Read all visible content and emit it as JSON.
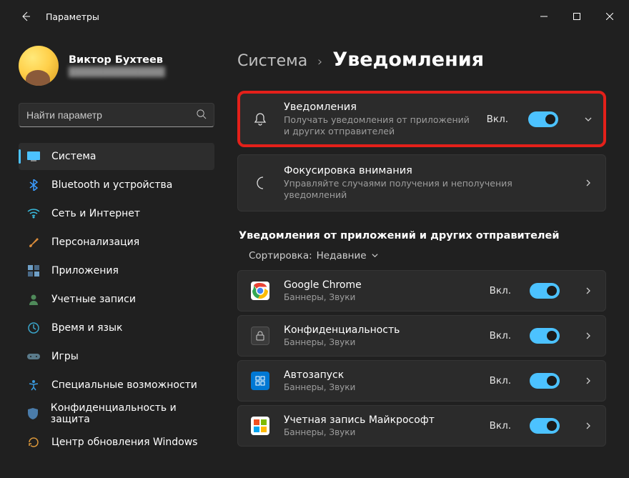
{
  "titlebar": {
    "title": "Параметры"
  },
  "profile": {
    "name": "Виктор Бухтеев",
    "email": "██████████████"
  },
  "search": {
    "placeholder": "Найти параметр"
  },
  "sidebar": {
    "items": [
      {
        "label": "Система",
        "active": true
      },
      {
        "label": "Bluetooth и устройства",
        "active": false
      },
      {
        "label": "Сеть и Интернет",
        "active": false
      },
      {
        "label": "Персонализация",
        "active": false
      },
      {
        "label": "Приложения",
        "active": false
      },
      {
        "label": "Учетные записи",
        "active": false
      },
      {
        "label": "Время и язык",
        "active": false
      },
      {
        "label": "Игры",
        "active": false
      },
      {
        "label": "Специальные возможности",
        "active": false
      },
      {
        "label": "Конфиденциальность и защита",
        "active": false
      },
      {
        "label": "Центр обновления Windows",
        "active": false
      }
    ]
  },
  "breadcrumb": {
    "a": "Система",
    "b": "Уведомления"
  },
  "cards": {
    "notifications": {
      "title": "Уведомления",
      "sub": "Получать уведомления от приложений и других отправителей",
      "state": "Вкл."
    },
    "focus": {
      "title": "Фокусировка внимания",
      "sub": "Управляйте случаями получения и неполучения уведомлений"
    }
  },
  "section": {
    "title": "Уведомления от приложений и других отправителей",
    "sort_label": "Сортировка:",
    "sort_value": "Недавние"
  },
  "apps": [
    {
      "title": "Google Chrome",
      "sub": "Баннеры, Звуки",
      "state": "Вкл."
    },
    {
      "title": "Конфиденциальность",
      "sub": "Баннеры, Звуки",
      "state": "Вкл."
    },
    {
      "title": "Автозапуск",
      "sub": "Баннеры, Звуки",
      "state": "Вкл."
    },
    {
      "title": "Учетная запись Майкрософт",
      "sub": "Баннеры, Звуки",
      "state": "Вкл."
    }
  ]
}
